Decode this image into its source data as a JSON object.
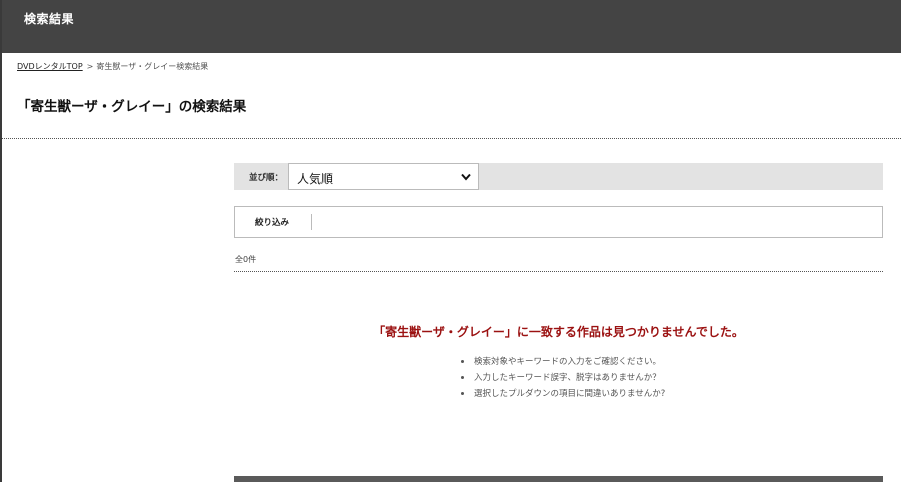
{
  "header": {
    "title": "検索結果"
  },
  "breadcrumb": {
    "home_link": "DVDレンタルTOP",
    "separator": ">",
    "current": "寄生獣ーザ・グレイー検索結果"
  },
  "page_title": "「寄生獣ーザ・グレイー」の検索結果",
  "sort": {
    "label": "並び順：",
    "selected": "人気順"
  },
  "filter": {
    "label": "絞り込み"
  },
  "result_count": "全0件",
  "no_result_message": "「寄生獣ーザ・グレイー」に一致する作品は見つかりませんでした。",
  "hints": [
    "検索対象やキーワードの入力をご確認ください。",
    "入力したキーワード誤字、脱字はありませんか？",
    "選択したプルダウンの項目に間違いありませんか?"
  ],
  "colors": {
    "header_bg": "#444444",
    "error_text": "#9b1111",
    "sort_bar_bg": "#e3e3e3"
  },
  "icons": {
    "select_arrow": "chevron-down-icon"
  }
}
